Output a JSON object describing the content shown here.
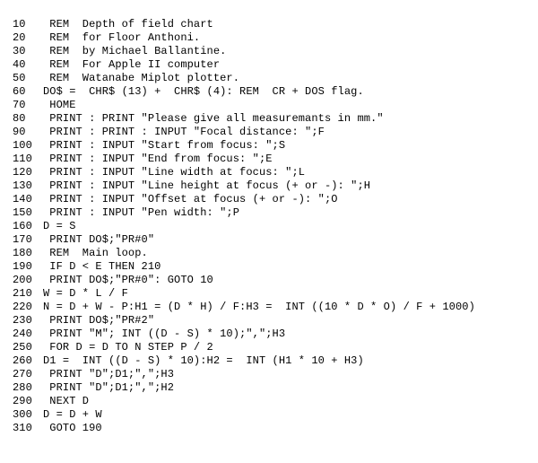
{
  "lines": [
    {
      "num": "10",
      "code": " REM  Depth of field chart"
    },
    {
      "num": "20",
      "code": " REM  for Floor Anthoni."
    },
    {
      "num": "30",
      "code": " REM  by Michael Ballantine."
    },
    {
      "num": "40",
      "code": " REM  For Apple II computer"
    },
    {
      "num": "50",
      "code": " REM  Watanabe Miplot plotter."
    },
    {
      "num": "60",
      "code": "DO$ =  CHR$ (13) +  CHR$ (4): REM  CR + DOS flag."
    },
    {
      "num": "70",
      "code": " HOME"
    },
    {
      "num": "80",
      "code": " PRINT : PRINT \"Please give all measuremants in mm.\""
    },
    {
      "num": "90",
      "code": " PRINT : PRINT : INPUT \"Focal distance: \";F"
    },
    {
      "num": "100",
      "code": " PRINT : INPUT \"Start from focus: \";S"
    },
    {
      "num": "110",
      "code": " PRINT : INPUT \"End from focus: \";E"
    },
    {
      "num": "120",
      "code": " PRINT : INPUT \"Line width at focus: \";L"
    },
    {
      "num": "130",
      "code": " PRINT : INPUT \"Line height at focus (+ or -): \";H"
    },
    {
      "num": "140",
      "code": " PRINT : INPUT \"Offset at focus (+ or -): \";O"
    },
    {
      "num": "150",
      "code": " PRINT : INPUT \"Pen width: \";P"
    },
    {
      "num": "160",
      "code": "D = S"
    },
    {
      "num": "170",
      "code": " PRINT DO$;\"PR#0\""
    },
    {
      "num": "180",
      "code": " REM  Main loop."
    },
    {
      "num": "190",
      "code": " IF D < E THEN 210"
    },
    {
      "num": "200",
      "code": " PRINT DO$;\"PR#0\": GOTO 10"
    },
    {
      "num": "210",
      "code": "W = D * L / F"
    },
    {
      "num": "220",
      "code": "N = D + W - P:H1 = (D * H) / F:H3 =  INT ((10 * D * O) / F + 1000)"
    },
    {
      "num": "230",
      "code": " PRINT DO$;\"PR#2\""
    },
    {
      "num": "240",
      "code": " PRINT \"M\"; INT ((D - S) * 10);\",\";H3"
    },
    {
      "num": "250",
      "code": " FOR D = D TO N STEP P / 2"
    },
    {
      "num": "260",
      "code": "D1 =  INT ((D - S) * 10):H2 =  INT (H1 * 10 + H3)"
    },
    {
      "num": "270",
      "code": " PRINT \"D\";D1;\",\";H3"
    },
    {
      "num": "280",
      "code": " PRINT \"D\";D1;\",\";H2"
    },
    {
      "num": "290",
      "code": " NEXT D"
    },
    {
      "num": "300",
      "code": "D = D + W"
    },
    {
      "num": "310",
      "code": " GOTO 190"
    }
  ]
}
